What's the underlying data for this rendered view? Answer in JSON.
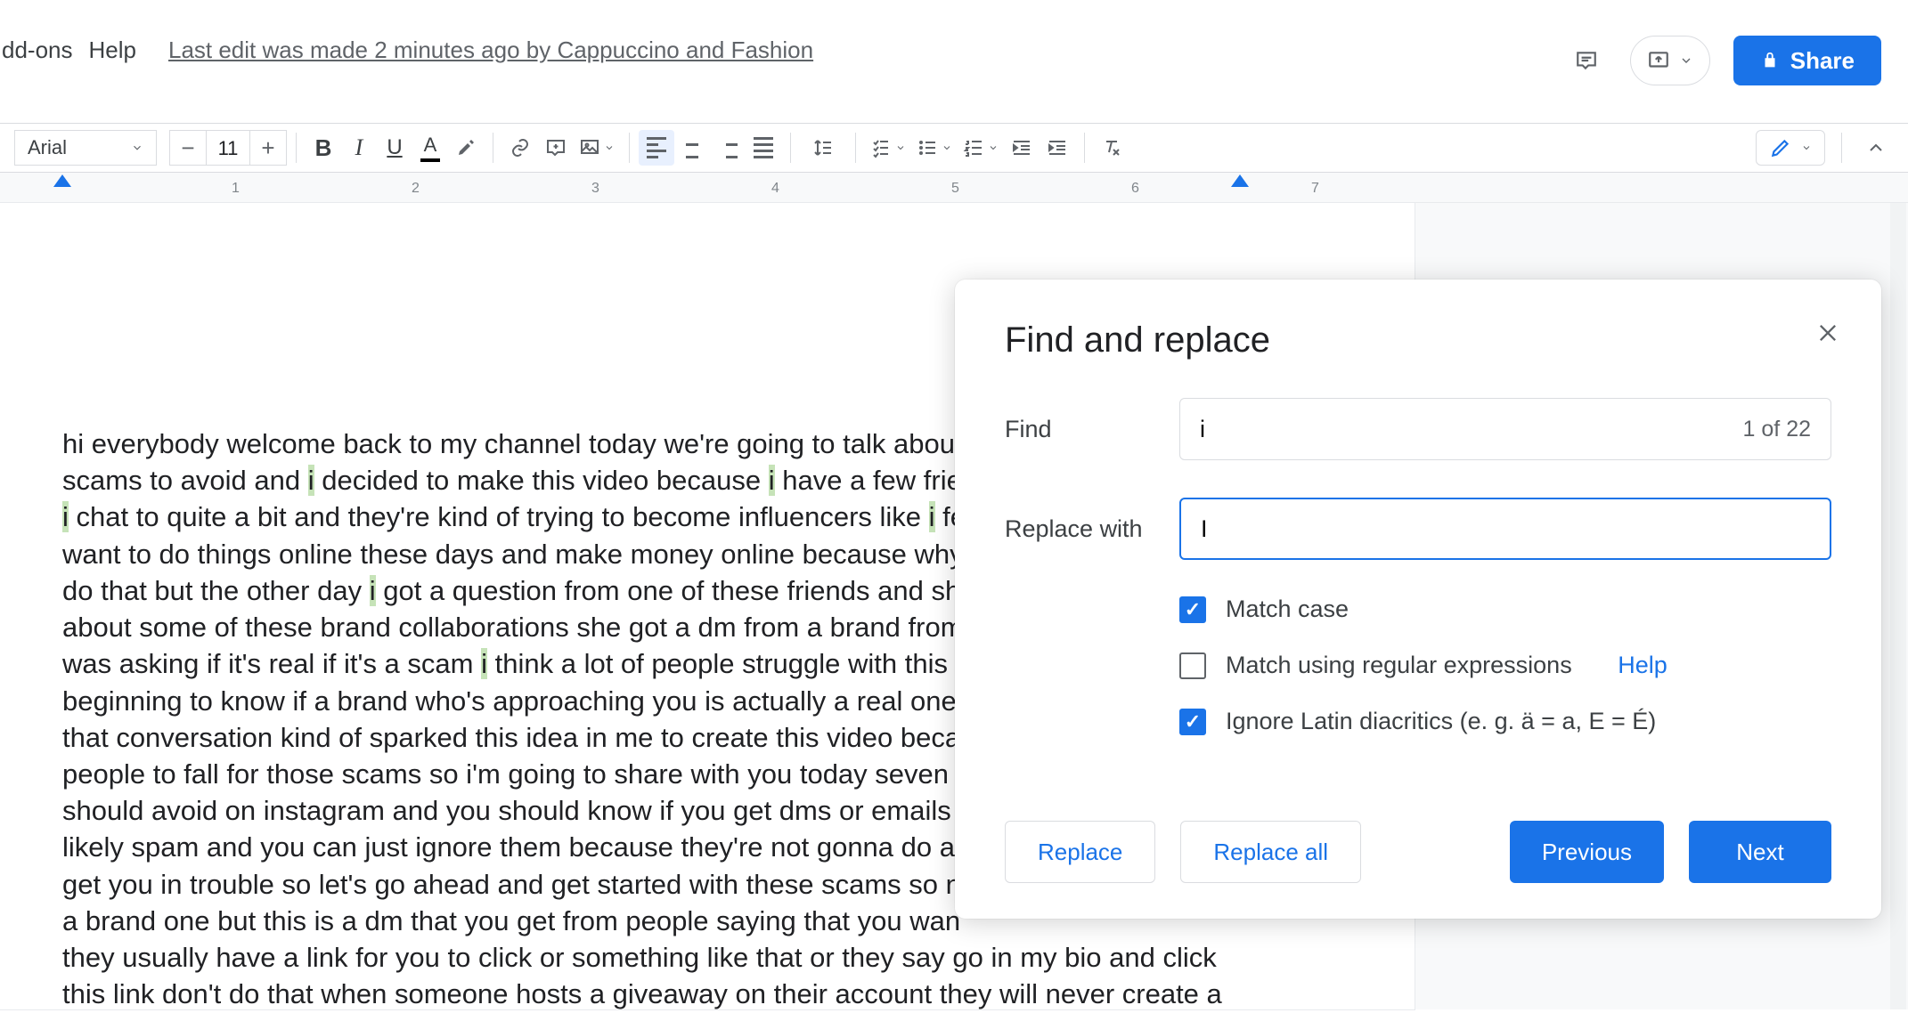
{
  "menu": {
    "addons": "dd-ons",
    "help": "Help"
  },
  "last_edit": "Last edit was made 2 minutes ago by Cappuccino and Fashion",
  "share_label": "Share",
  "toolbar": {
    "font_name": "Arial",
    "font_size": "11"
  },
  "ruler": {
    "marks": [
      "1",
      "2",
      "3",
      "4",
      "5",
      "6",
      "7"
    ]
  },
  "document": {
    "p1a": "hi everybody welcome back to my channel today we're going to talk abou",
    "p1b": "scams to avoid and",
    "p1c": "decided to make this video because",
    "p1d": "have a few frie",
    "p2a": "chat to quite a bit and they're kind of trying to become influencers like",
    "p2b": "fe",
    "p3": "want to do things online these days and make money online because why",
    "p4a": "do that but the other day",
    "p4b": "got a question from one of these friends and sh",
    "p5": "about some of these brand collaborations she got a dm from a brand from",
    "p6a": "was asking if it's real if it's a scam",
    "p6b": "think a lot of people struggle with this",
    "p7": "beginning to know if a brand who's approaching you is actually a real one",
    "p8": "that conversation kind of sparked this idea in me to create this video beca",
    "p9": "people to fall for those scams so i'm going to share with you today seven",
    "p10": "should avoid on instagram and you should know if you get dms or emails",
    "p11": "likely spam and you can just ignore them because they're not gonna do a",
    "p12": "get you in trouble so let's go ahead and get started with these scams so n",
    "p13": "a brand one but this is a dm that you get from people saying that you wan",
    "p14": "they usually have a link for you to click or something like that or they say go in my bio and click",
    "p15": "this link don't do that when someone hosts a giveaway on their account they will never create a",
    "hl": "i"
  },
  "dialog": {
    "title": "Find and replace",
    "find_label": "Find",
    "find_value": "i",
    "count": "1 of 22",
    "replace_label": "Replace with",
    "replace_value": "I",
    "opt_match_case": "Match case",
    "opt_regex": "Match using regular expressions",
    "opt_regex_help": "Help",
    "opt_diacritics": "Ignore Latin diacritics (e. g. ä = a, E = É)",
    "btn_replace": "Replace",
    "btn_replace_all": "Replace all",
    "btn_prev": "Previous",
    "btn_next": "Next"
  }
}
